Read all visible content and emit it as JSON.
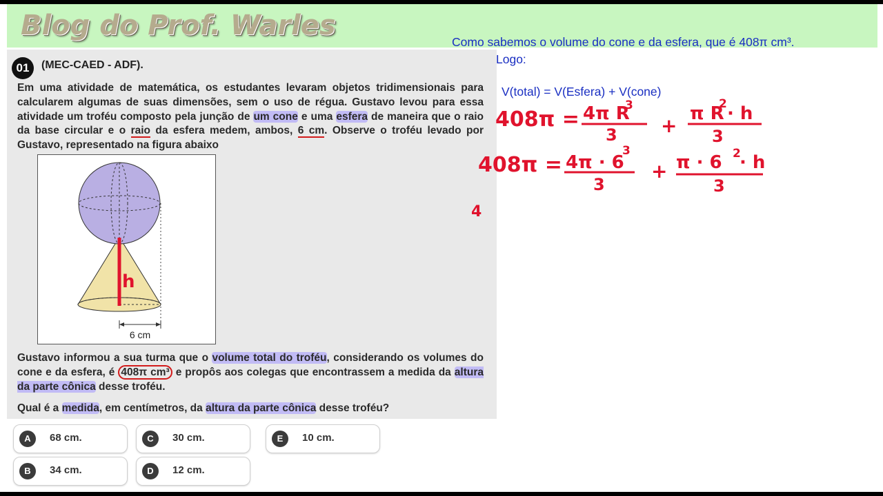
{
  "header": {
    "blog_title": "Blog do Prof. Warles"
  },
  "question": {
    "number": "01",
    "source": "(MEC-CAED - ADF).",
    "p1": {
      "a": "Em uma atividade de matemática, os estudantes levaram objetos tridimensionais para calcularem algumas de suas dimensões, sem o uso de régua. Gustavo levou para essa atividade um troféu composto pela junção de ",
      "b": "um cone",
      "c": " e uma ",
      "d": "esfera",
      "e": " de maneira que o raio da base circular e o ",
      "f": "raio",
      "g": " da esfera medem, ambos, ",
      "h": "6 cm",
      "i": ". Observe o troféu levado por Gustavo, representado na figura abaixo"
    },
    "figure": {
      "height_label": "h",
      "base_label": "6 cm"
    },
    "p2": {
      "a": "Gustavo informou a sua turma que o ",
      "b": "volume total do troféu",
      "c": ", considerando os volumes do cone e da esfera, é ",
      "d": "408π cm³",
      "e": " e propôs aos colegas que encontrassem a medida da ",
      "f": "altura da parte cônica",
      "g": " desse troféu."
    },
    "p3": {
      "a": "Qual é a ",
      "b": "medida",
      "c": ", em centímetros, da ",
      "d": "altura da parte cônica",
      "e": " desse troféu?"
    },
    "options": [
      {
        "letter": "A",
        "text": "68 cm."
      },
      {
        "letter": "B",
        "text": "34 cm."
      },
      {
        "letter": "C",
        "text": "30 cm."
      },
      {
        "letter": "D",
        "text": "12 cm."
      },
      {
        "letter": "E",
        "text": "10 cm."
      }
    ]
  },
  "solution": {
    "line1": "Como sabemos o volume do cone e da esfera, que é 408π cm³.",
    "line2": "Logo:",
    "line3": "V(total) = V(Esfera) + V(cone)",
    "eq1": {
      "lhs": "408π =",
      "num1": "4π R",
      "exp1": "3",
      "den1": "3",
      "plus": "+",
      "num2": "π R",
      "exp2": "2",
      "num2b": "· h",
      "den2": "3"
    },
    "eq2": {
      "lhs": "408π =",
      "num1": "4π · 6",
      "exp1": "3",
      "den1": "3",
      "plus": "+",
      "num2": "π · 6",
      "exp2": "2",
      "num2b": "· h",
      "den2": "3"
    },
    "eq3_start": "4"
  },
  "colors": {
    "handwriting": "#e0132d",
    "solution_text": "#1a2fc2",
    "highlight": "#a096ff",
    "header_band": "#c8f6c0"
  }
}
